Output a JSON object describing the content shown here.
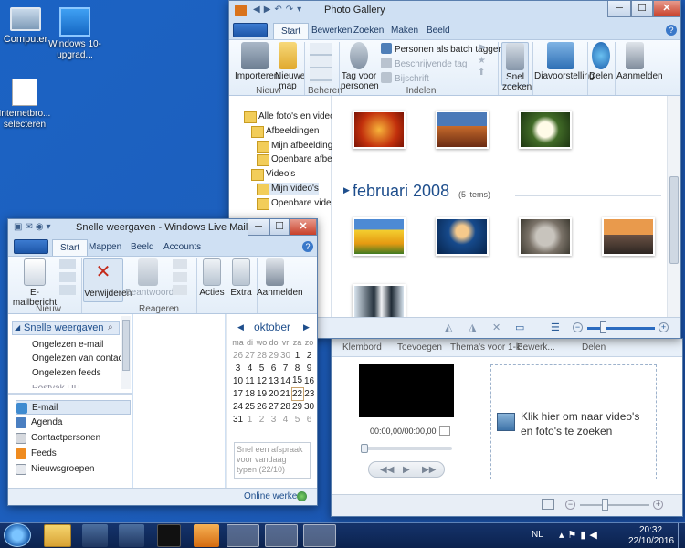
{
  "desktop": {
    "icons": [
      {
        "label": "Computer"
      },
      {
        "label": "Windows 10-upgrad..."
      },
      {
        "label": "Internetbro... selecteren"
      }
    ]
  },
  "photo_gallery": {
    "title": "Photo Gallery",
    "tabs": [
      "Start",
      "Bewerken",
      "Zoeken",
      "Maken",
      "Beeld"
    ],
    "ribbon": {
      "importeren": "Importeren",
      "nieuwe_map": "Nieuwe map",
      "group_nieuw": "Nieuw",
      "group_beheren": "Beheren",
      "tag_voor_personen": "Tag voor personen",
      "personen_batch": "Personen als batch taggen",
      "beschrijvende_tag": "Beschrijvende tag",
      "bijschrift": "Bijschrift",
      "group_indelen": "Indelen",
      "snel_zoeken": "Snel zoeken",
      "diavoorstelling": "Diavoorstelling",
      "delen": "Delen",
      "aanmelden": "Aanmelden"
    },
    "tree": [
      "Alle foto's en video's",
      "Afbeeldingen",
      "Mijn afbeeldingen",
      "Openbare afbeeldi...",
      "Video's",
      "Mijn video's",
      "Openbare video's"
    ],
    "section_title": "februari 2008",
    "section_count": "(5 items)",
    "colors": {
      "accent": "#1e4e8c"
    }
  },
  "movie_maker": {
    "tabs": [
      "Klembord",
      "Toevoegen",
      "Thema's voor 1-k...",
      "Bewerk...",
      "Delen"
    ],
    "time": "00:00,00/00:00,00",
    "hint": "Klik hier om naar video's en foto's te zoeken"
  },
  "mail": {
    "title": "Snelle weergaven - Windows Live Mail",
    "tabs": [
      "Start",
      "Mappen",
      "Beeld",
      "Accounts"
    ],
    "ribbon": {
      "emailbericht": "E-mailbericht",
      "verwijderen": "Verwijderen",
      "beantwoorden": "Beantwoorden",
      "acties": "Acties",
      "extra": "Extra",
      "aanmelden": "Aanmelden",
      "group_nieuw": "Nieuw",
      "group_reageren": "Reageren"
    },
    "quick_views_header": "Snelle weergaven",
    "quick_views": [
      "Ongelezen e-mail",
      "Ongelezen van contac...",
      "Ongelezen feeds",
      "Postvak UIT"
    ],
    "nav": [
      "E-mail",
      "Agenda",
      "Contactpersonen",
      "Feeds",
      "Nieuwsgroepen"
    ],
    "calendar": {
      "month": "oktober",
      "weekdays": [
        "ma",
        "di",
        "wo",
        "do",
        "vr",
        "za",
        "zo"
      ],
      "weeks": [
        [
          "26",
          "27",
          "28",
          "29",
          "30",
          "1",
          "2"
        ],
        [
          "3",
          "4",
          "5",
          "6",
          "7",
          "8",
          "9"
        ],
        [
          "10",
          "11",
          "12",
          "13",
          "14",
          "15",
          "16"
        ],
        [
          "17",
          "18",
          "19",
          "20",
          "21",
          "22",
          "23"
        ],
        [
          "24",
          "25",
          "26",
          "27",
          "28",
          "29",
          "30"
        ],
        [
          "31",
          "1",
          "2",
          "3",
          "4",
          "5",
          "6"
        ]
      ],
      "today": "22"
    },
    "appointment_placeholder": "Snel een afspraak voor vandaag typen (22/10)",
    "status": "Online werken"
  },
  "taskbar": {
    "language": "NL",
    "time": "20:32",
    "date": "22/10/2016"
  }
}
